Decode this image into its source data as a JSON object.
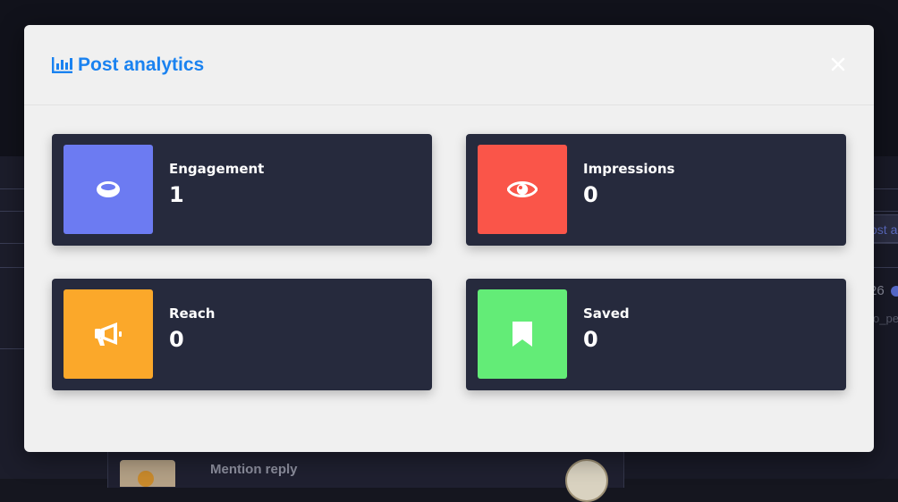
{
  "modal": {
    "title": "Post analytics",
    "title_icon": "bar-chart-icon",
    "close_icon": "close-icon"
  },
  "stats": [
    {
      "label": "Engagement",
      "value": "1",
      "icon": "ring-icon",
      "color": "#6c7bf2"
    },
    {
      "label": "Impressions",
      "value": "0",
      "icon": "eye-icon",
      "color": "#fa5549"
    },
    {
      "label": "Reach",
      "value": "0",
      "icon": "megaphone-icon",
      "color": "#fba82a"
    },
    {
      "label": "Saved",
      "value": "0",
      "icon": "bookmark-icon",
      "color": "#63ec77"
    }
  ],
  "background": {
    "button_partial": "ost a",
    "count_partial": "26",
    "handle_partial": "o_pe",
    "mention_title": "Mention reply"
  },
  "colors": {
    "accent": "#1a82f0",
    "card_bg": "#262a3d",
    "modal_bg": "#f0f0f0"
  }
}
